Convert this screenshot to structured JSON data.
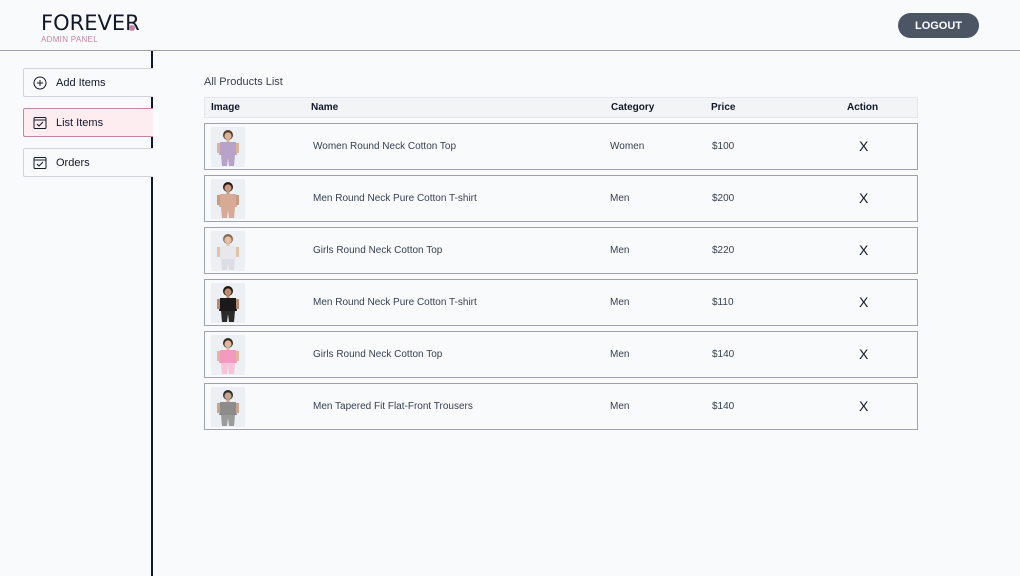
{
  "header": {
    "logo_text": "FOREVER",
    "logo_subtitle": "ADMIN PANEL",
    "logout_label": "LOGOUT"
  },
  "sidebar": {
    "items": [
      {
        "label": "Add Items",
        "icon": "plus-circle-icon",
        "active": false
      },
      {
        "label": "List Items",
        "icon": "checklist-icon",
        "active": true
      },
      {
        "label": "Orders",
        "icon": "checklist-icon",
        "active": false
      }
    ]
  },
  "products": {
    "title": "All Products List",
    "columns": [
      "Image",
      "Name",
      "Category",
      "Price",
      "Action"
    ],
    "rows": [
      {
        "name": "Women Round Neck Cotton Top",
        "category": "Women",
        "price": "$100",
        "action": "X",
        "skin": "#d9b49b",
        "top": "#b8a2c8",
        "bottom": "#b8a2c8",
        "hair": "#5b3a29"
      },
      {
        "name": "Men Round Neck Pure Cotton T-shirt",
        "category": "Men",
        "price": "$200",
        "action": "X",
        "skin": "#c99a80",
        "top": "#d7aa96",
        "bottom": "#d7aa96",
        "hair": "#2b1d16"
      },
      {
        "name": "Girls Round Neck Cotton Top",
        "category": "Men",
        "price": "$220",
        "action": "X",
        "skin": "#e3c1a8",
        "top": "#e8e8ec",
        "bottom": "#dcdde3",
        "hair": "#8a6a4c"
      },
      {
        "name": "Men Round Neck Pure Cotton T-shirt",
        "category": "Men",
        "price": "$110",
        "action": "X",
        "skin": "#b88a70",
        "top": "#1a1a1a",
        "bottom": "#2b2b2b",
        "hair": "#1e1611"
      },
      {
        "name": "Girls Round Neck Cotton Top",
        "category": "Men",
        "price": "$140",
        "action": "X",
        "skin": "#e0b79c",
        "top": "#f29ac0",
        "bottom": "#f7c3d8",
        "hair": "#3d2a1e"
      },
      {
        "name": "Men Tapered Fit Flat-Front Trousers",
        "category": "Men",
        "price": "$140",
        "action": "X",
        "skin": "#c9a58d",
        "top": "#8c8c8c",
        "bottom": "#9b9b9b",
        "hair": "#2d2d2d"
      }
    ]
  },
  "colors": {
    "accent": "#c586a5",
    "logout_bg": "#4b5563",
    "active_bg": "#fdecf0"
  }
}
